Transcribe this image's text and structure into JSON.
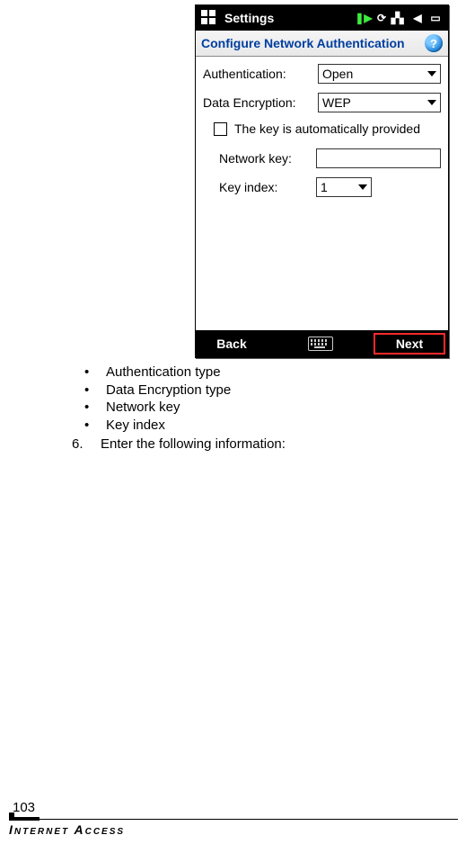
{
  "statusbar": {
    "title": "Settings"
  },
  "header": {
    "title": "Configure Network Authentication",
    "help": "?"
  },
  "form": {
    "auth_label": "Authentication:",
    "auth_value": "Open",
    "encrypt_label": "Data Encryption:",
    "encrypt_value": "WEP",
    "auto_key_label": "The key is automatically provided",
    "net_key_label": "Network key:",
    "net_key_value": "",
    "key_index_label": "Key index:",
    "key_index_value": "1"
  },
  "softbar": {
    "left": "Back",
    "right": "Next"
  },
  "bullets": [
    "Authentication type",
    "Data Encryption type",
    "Network key",
    "Key index"
  ],
  "step": {
    "num": "6.",
    "text": "Enter the following information:"
  },
  "footer": {
    "page": "103",
    "section": "Internet Access"
  }
}
